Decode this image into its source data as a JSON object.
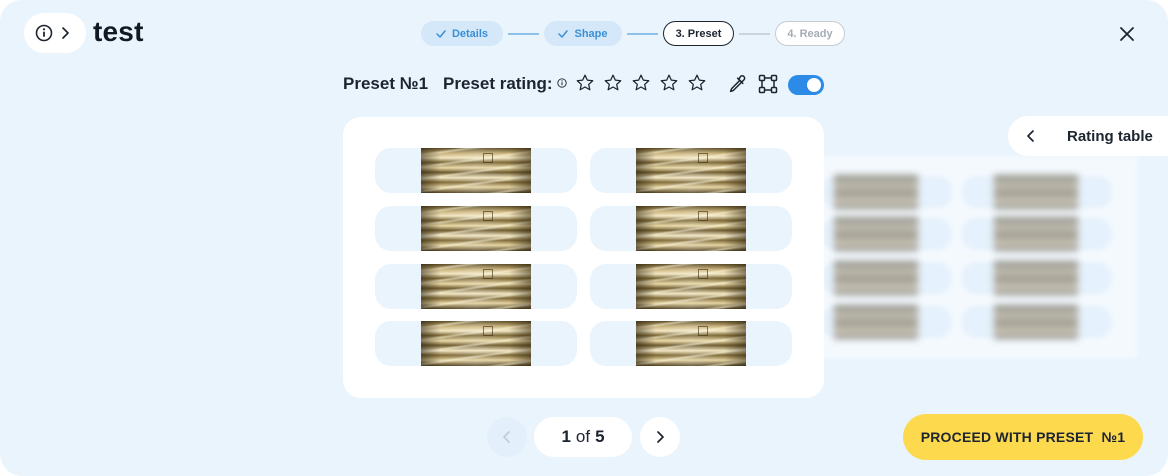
{
  "header": {
    "title": "test",
    "info_icon": "info-circle-icon",
    "chevron_icon": "chevron-right-icon",
    "close_icon": "close-icon"
  },
  "stepper": {
    "steps": [
      {
        "label": "Details",
        "state": "done"
      },
      {
        "label": "Shape",
        "state": "done"
      },
      {
        "label": "3. Preset",
        "state": "current"
      },
      {
        "label": "4. Ready",
        "state": "pending"
      }
    ]
  },
  "preset_bar": {
    "name": "Preset №1",
    "rating_label": "Preset rating:",
    "rating_value": 0,
    "rating_max": 5,
    "tools": [
      "eyedropper-icon",
      "crop-frame-icon"
    ],
    "toggle_on": true
  },
  "rating_table": {
    "label": "Rating table"
  },
  "pager": {
    "current": "1",
    "of": "of",
    "total": "5"
  },
  "actions": {
    "proceed_label": "PROCEED WITH PRESET  №1"
  },
  "colors": {
    "background": "#eaf4fd",
    "accent": "#2b8be6",
    "step_done_bg": "#d4e8f9",
    "step_done_text": "#3a8fd6",
    "primary_button": "#fdd94e"
  }
}
